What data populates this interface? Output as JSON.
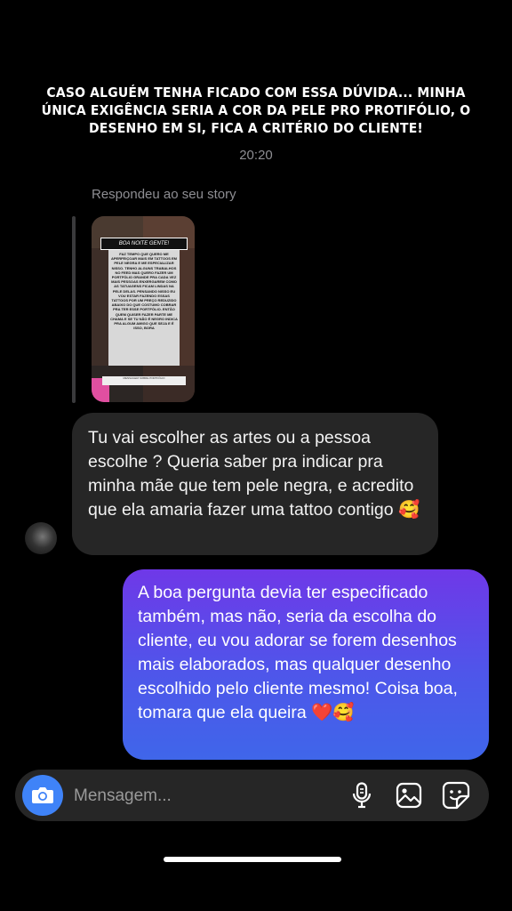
{
  "story_caption": "CASO ALGUÉM TENHA FICADO COM ESSA DÚVIDA... MINHA ÚNICA EXIGÊNCIA SERIA A COR DA PELE PRO PROTIFÓLIO, O DESENHO EM SI, FICA A CRITÉRIO DO CLIENTE!",
  "timestamp": "20:20",
  "reply_label": "Respondeu ao seu story",
  "story_thumb": {
    "banner": "BOA NOITE GENTE!",
    "text": "FAZ TEMPO QUE QUERO ME APERFEIÇOAR MAIS EM TATTOOS EM PELE NEGRA E ME ESPECIALIZAR NISSO. TENHO ALGUNS TRABALHOS NO FEED MAS QUERO FAZER UM PORTFÓLIO GRANDE PRA CADA VEZ MAIS PESSOAS ENXERGAREM COMO AS TATUAGENS FICAM LINDAS NA PELE DELAS. PENSANDO NISSO EU VOU ESTAR FAZENDO ESSAS TATTOOS POR UM PREÇO REDUZIDO ABAIXO DO QUE COSTUMO COBRAR PRA TER ESSE PORTFÓLIO. ENTÃO QUEM QUISER FAZER PARTE ME CHAMA E SE TU NÃO É NEGRO INDICA PRA ALGUM AMIGO QUE SEJA E É ISSO, BORA",
    "footer": "MENSAGEM SOBRE PORTFÓLIO"
  },
  "messages": {
    "incoming": "Tu vai escolher as artes ou a pessoa escolhe ?  Queria saber pra indicar pra minha mãe que tem pele negra, e acredito que ela amaria fazer uma tattoo contigo 🥰",
    "outgoing": "A boa pergunta devia ter especificado também, mas não, seria da escolha do cliente, eu vou adorar se forem desenhos mais elaborados, mas qualquer desenho escolhido pelo cliente mesmo! Coisa boa, tomara que ela queira ❤️🥰"
  },
  "composer": {
    "placeholder": "Mensagem...",
    "icons": [
      "camera-icon",
      "microphone-icon",
      "gallery-icon",
      "sticker-icon"
    ]
  },
  "colors": {
    "background": "#000000",
    "incoming_bubble": "#262626",
    "outgoing_gradient_start": "#6f38e8",
    "outgoing_gradient_end": "#3f66ea",
    "camera_button": "#3f83f8"
  }
}
